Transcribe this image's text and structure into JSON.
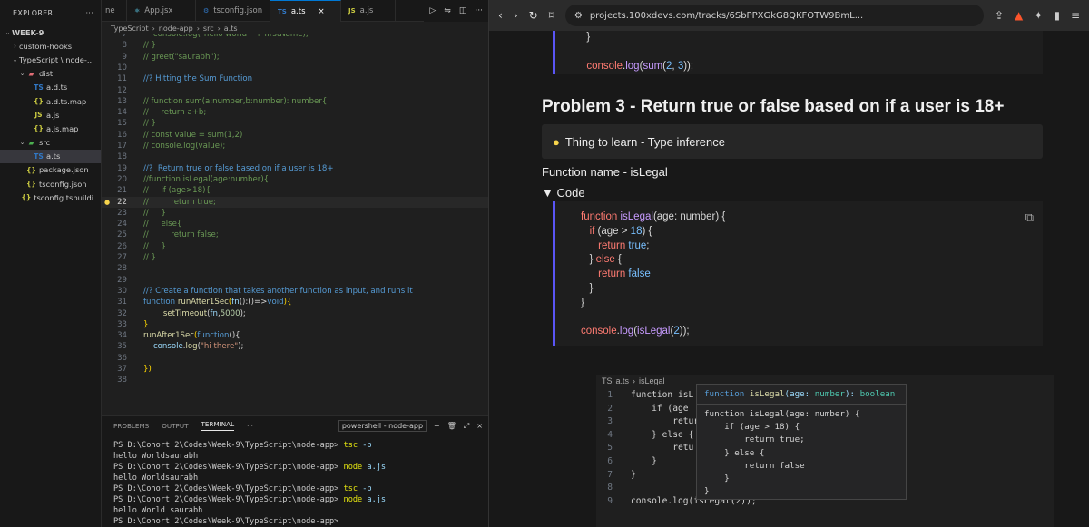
{
  "vscode": {
    "explorer": {
      "title": "EXPLORER",
      "items": [
        {
          "label": "WEEK-9",
          "indent": 0,
          "twisty": "⌄",
          "bold": true
        },
        {
          "label": "custom-hooks",
          "indent": 1,
          "twisty": "›"
        },
        {
          "label": "TypeScript \\ node-...",
          "indent": 1,
          "twisty": "⌄"
        },
        {
          "label": "dist",
          "indent": 2,
          "twisty": "⌄",
          "icon": "dist-folder"
        },
        {
          "label": "a.d.ts",
          "indent": 3,
          "icon": "ts"
        },
        {
          "label": "a.d.ts.map",
          "indent": 3,
          "icon": "map"
        },
        {
          "label": "a.js",
          "indent": 3,
          "icon": "js"
        },
        {
          "label": "a.js.map",
          "indent": 3,
          "icon": "map"
        },
        {
          "label": "src",
          "indent": 2,
          "twisty": "⌄",
          "icon": "src-folder"
        },
        {
          "label": "a.ts",
          "indent": 3,
          "icon": "ts",
          "selected": true
        },
        {
          "label": "package.json",
          "indent": 2,
          "icon": "json"
        },
        {
          "label": "tsconfig.json",
          "indent": 2,
          "icon": "json"
        },
        {
          "label": "tsconfig.tsbuildi...",
          "indent": 2,
          "icon": "json"
        }
      ]
    },
    "tabs": [
      {
        "label": "ne",
        "icon": ""
      },
      {
        "label": "App.jsx",
        "icon": "react"
      },
      {
        "label": "tsconfig.json",
        "icon": "tsconfig"
      },
      {
        "label": "a.ts",
        "icon": "TS",
        "active": true,
        "close": "×"
      },
      {
        "label": "a.js",
        "icon": "JS"
      }
    ],
    "breadcrumb": [
      "TypeScript",
      "node-app",
      "src",
      "a.ts"
    ],
    "code": [
      {
        "n": "7",
        "t": "    console.log(\"hello world \" + firstName);",
        "c": "cm"
      },
      {
        "n": "8",
        "t": "// }",
        "c": "cm"
      },
      {
        "n": "9",
        "t": "// greet(\"saurabh\");",
        "c": "cm"
      },
      {
        "n": "10",
        "t": ""
      },
      {
        "n": "11",
        "t": "//? Hitting the Sum Function",
        "c": "kw"
      },
      {
        "n": "12",
        "t": ""
      },
      {
        "n": "13",
        "t": "// function sum(a:number,b:number): number{",
        "c": "cm"
      },
      {
        "n": "14",
        "t": "//     return a+b;",
        "c": "cm"
      },
      {
        "n": "15",
        "t": "// }",
        "c": "cm"
      },
      {
        "n": "16",
        "t": "// const value = sum(1,2)",
        "c": "cm"
      },
      {
        "n": "17",
        "t": "// console.log(value);",
        "c": "cm"
      },
      {
        "n": "18",
        "t": ""
      },
      {
        "n": "19",
        "t": "//?  Return true or false based on if a user is 18+",
        "c": "kw"
      },
      {
        "n": "20",
        "t": "//function isLegal(age:number){",
        "c": "cm"
      },
      {
        "n": "21",
        "t": "//     if (age>18){",
        "c": "cm"
      },
      {
        "n": "22",
        "t": "//         return true;",
        "c": "cm",
        "cur": true
      },
      {
        "n": "23",
        "t": "//     }",
        "c": "cm"
      },
      {
        "n": "24",
        "t": "//     else{",
        "c": "cm"
      },
      {
        "n": "25",
        "t": "//         return false;",
        "c": "cm"
      },
      {
        "n": "26",
        "t": "//     }",
        "c": "cm"
      },
      {
        "n": "27",
        "t": "// }",
        "c": "cm"
      },
      {
        "n": "28",
        "t": ""
      },
      {
        "n": "29",
        "t": ""
      },
      {
        "n": "30",
        "t": "//? Create a function that takes another function as input, and runs it",
        "c": "kw"
      },
      {
        "n": "31",
        "t": "function runAfter1Sec(fn:()=>void){",
        "c": "mix1"
      },
      {
        "n": "32",
        "t": "        setTimeout(fn,5000);",
        "c": "mix2"
      },
      {
        "n": "33",
        "t": "}",
        "c": "br"
      },
      {
        "n": "34",
        "t": "runAfter1Sec(function(){",
        "c": "mix3"
      },
      {
        "n": "35",
        "t": "    console.log(\"hi there\");",
        "c": "mix4"
      },
      {
        "n": "36",
        "t": ""
      },
      {
        "n": "37",
        "t": "})",
        "c": "br"
      },
      {
        "n": "38",
        "t": ""
      }
    ],
    "panel": {
      "tabs": [
        "PROBLEMS",
        "OUTPUT",
        "TERMINAL",
        "···"
      ],
      "shell": "powershell - node-app",
      "lines": [
        {
          "p": "PS D:\\Cohort 2\\Codes\\Week-9\\TypeScript\\node-app> ",
          "c": "tsc",
          "a": " -b"
        },
        {
          "p": "hello Worldsaurabh"
        },
        {
          "p": "PS D:\\Cohort 2\\Codes\\Week-9\\TypeScript\\node-app> ",
          "c": "node",
          "a": " a.js"
        },
        {
          "p": "hello Worldsaurabh"
        },
        {
          "p": "PS D:\\Cohort 2\\Codes\\Week-9\\TypeScript\\node-app> ",
          "c": "tsc",
          "a": " -b"
        },
        {
          "p": "PS D:\\Cohort 2\\Codes\\Week-9\\TypeScript\\node-app> ",
          "c": "node",
          "a": " a.js"
        },
        {
          "p": "hello World saurabh"
        },
        {
          "p": "PS D:\\Cohort 2\\Codes\\Week-9\\TypeScript\\node-app> "
        }
      ]
    }
  },
  "browser": {
    "url": "projects.100xdevs.com/tracks/6SbPPXGkG8QKFOTW9BmL...",
    "top_code": [
      "  }",
      "",
      "  console.log(sum(2, 3));"
    ],
    "heading": "Problem 3 - Return true or false based on if a user is 18+",
    "callout": "Thing to learn - Type inference",
    "fn_name": "Function name - isLegal",
    "code_toggle": "▼ Code",
    "preview": {
      "crumb": [
        "a.ts",
        "isLegal"
      ],
      "lines": [
        {
          "n": "1",
          "t": "function isL"
        },
        {
          "n": "2",
          "t": "    if (age"
        },
        {
          "n": "3",
          "t": "        retur"
        },
        {
          "n": "4",
          "t": "    } else {"
        },
        {
          "n": "5",
          "t": "        retu"
        },
        {
          "n": "6",
          "t": "    }"
        },
        {
          "n": "7",
          "t": "}"
        },
        {
          "n": "8",
          "t": ""
        },
        {
          "n": "9",
          "t": "console.log(isLegal(2));"
        }
      ],
      "hover_sig": "function isLegal(age: number): boolean",
      "hover_body": [
        "function isLegal(age: number) {",
        "    if (age > 18) {",
        "        return true;",
        "    } else {",
        "        return false",
        "    }",
        "}"
      ]
    }
  }
}
